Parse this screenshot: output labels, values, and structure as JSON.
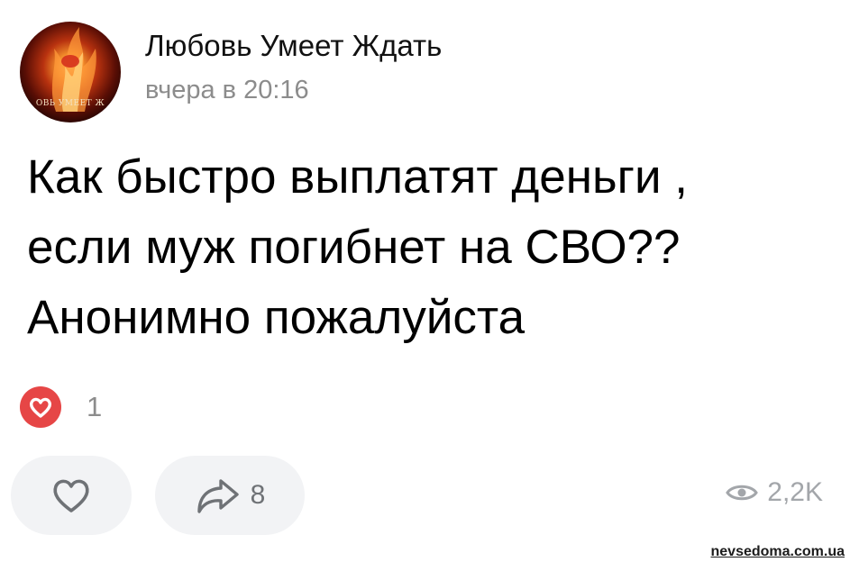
{
  "post": {
    "author": "Любовь Умеет Ждать",
    "timestamp": "вчера в 20:16",
    "avatar_caption": "ОВЬ УМЕЕТ Ж",
    "text_lines": [
      "Как быстро выплатят деньги ,",
      "если муж погибнет на СВО??",
      "Анонимно пожалуйста"
    ]
  },
  "reactions": {
    "icon": "heart-reaction-icon",
    "count": "1",
    "color": "#e64646"
  },
  "actions": {
    "like_icon": "heart-outline-icon",
    "share_icon": "share-arrow-icon",
    "share_count": "8",
    "views_icon": "eye-icon",
    "views_count": "2,2K"
  },
  "watermark": "nevsedoma.com.ua"
}
